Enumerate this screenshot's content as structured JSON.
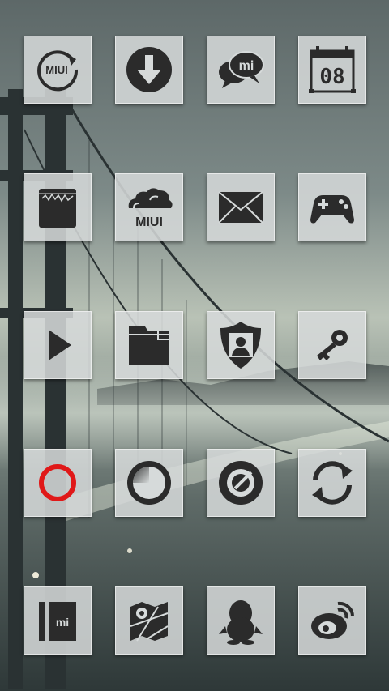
{
  "colors": {
    "tile_background": "#d6dada",
    "icon_color": "#2b2b2b",
    "accent_red": "#e01818"
  },
  "home_screen": {
    "rows": [
      [
        {
          "name": "miui-update-icon",
          "label_text": "MIUI"
        },
        {
          "name": "download-icon"
        },
        {
          "name": "mi-talk-chat-icon",
          "label_text": "mi"
        },
        {
          "name": "calendar-icon",
          "label_text": "08"
        }
      ],
      [
        {
          "name": "notes-icon"
        },
        {
          "name": "miui-cloud-icon",
          "label_text": "MIUI"
        },
        {
          "name": "mail-envelope-icon"
        },
        {
          "name": "gamepad-icon"
        }
      ],
      [
        {
          "name": "play-icon"
        },
        {
          "name": "folder-icon"
        },
        {
          "name": "security-shield-icon"
        },
        {
          "name": "key-icon"
        }
      ],
      [
        {
          "name": "red-ring-icon"
        },
        {
          "name": "circle-dial-icon"
        },
        {
          "name": "compass-circle-icon"
        },
        {
          "name": "sync-arrows-icon"
        }
      ],
      [
        {
          "name": "mi-store-icon",
          "label_text": "mi"
        },
        {
          "name": "map-location-icon"
        },
        {
          "name": "qq-penguin-icon"
        },
        {
          "name": "weibo-icon"
        }
      ]
    ]
  }
}
